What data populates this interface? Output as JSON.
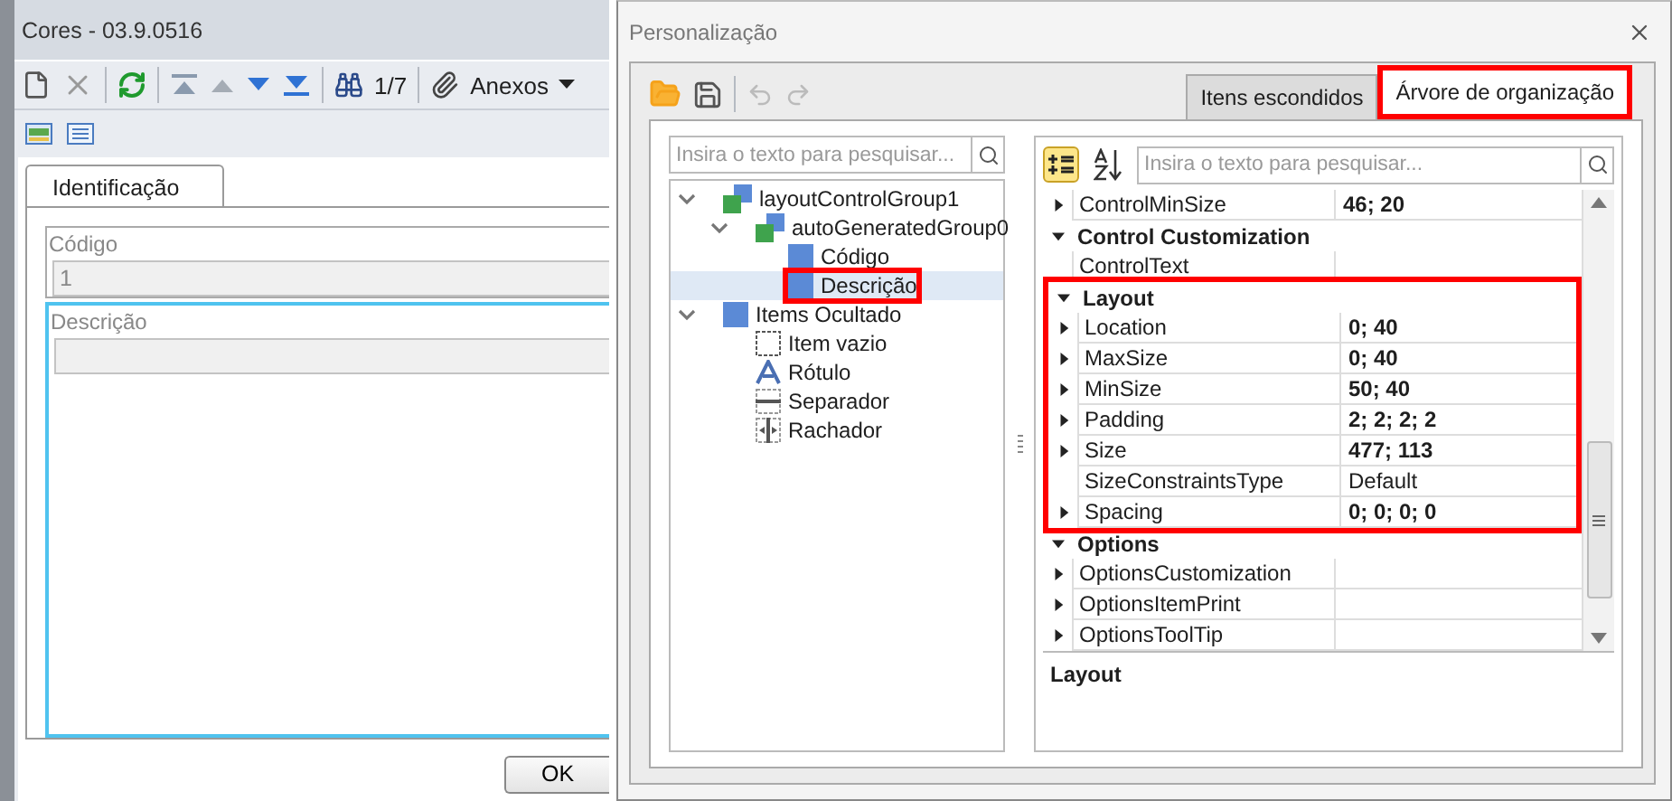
{
  "main_window": {
    "title": "Cores - 03.9.0516",
    "toolbar": {
      "record_counter": "1/7",
      "attachments_label": "Anexos"
    },
    "tabs": [
      {
        "label": "Identificação",
        "selected": true
      }
    ],
    "fields": [
      {
        "label": "Código",
        "value": "1",
        "focused": false
      },
      {
        "label": "Descrição",
        "focused": true
      }
    ],
    "ok_button": "OK"
  },
  "dialog": {
    "title": "Personalização",
    "tabs": [
      {
        "label": "Itens escondidos",
        "selected": false,
        "highlighted": false
      },
      {
        "label": "Árvore de organização",
        "selected": true,
        "highlighted": true
      }
    ],
    "tree_search": {
      "placeholder": "Insira o texto para pesquisar..."
    },
    "tree": [
      {
        "label": "layoutControlGroup1",
        "kind": "group",
        "expanded": true,
        "selected": false,
        "highlighted": false,
        "children": [
          {
            "label": "autoGeneratedGroup0",
            "kind": "group",
            "expanded": true,
            "selected": false,
            "highlighted": false,
            "children": [
              {
                "label": "Código",
                "kind": "item",
                "selected": false,
                "highlighted": false
              },
              {
                "label": "Descrição",
                "kind": "item",
                "selected": true,
                "highlighted": true
              }
            ]
          }
        ]
      },
      {
        "label": "Items Ocultado",
        "kind": "item",
        "expanded": true,
        "selected": false,
        "highlighted": false,
        "children": [
          {
            "label": "Item vazio",
            "kind": "empty",
            "selected": false,
            "highlighted": false
          },
          {
            "label": "Rótulo",
            "kind": "label",
            "selected": false,
            "highlighted": false
          },
          {
            "label": "Separador",
            "kind": "separator",
            "selected": false,
            "highlighted": false
          },
          {
            "label": "Rachador",
            "kind": "splitter",
            "selected": false,
            "highlighted": false
          }
        ]
      }
    ],
    "property_search": {
      "placeholder": "Insira o texto para pesquisar..."
    },
    "property_groups": [
      {
        "rows": [
          {
            "name": "ControlMinSize",
            "value": "46; 20",
            "expandable": true,
            "modified": true
          }
        ]
      },
      {
        "name": "Control Customization",
        "expanded": true,
        "highlighted": false,
        "rows": [
          {
            "name": "ControlText",
            "expandable": false
          }
        ]
      },
      {
        "name": "Layout",
        "expanded": true,
        "highlighted": true,
        "rows": [
          {
            "name": "Location",
            "value": "0; 40",
            "expandable": true,
            "modified": true
          },
          {
            "name": "MaxSize",
            "value": "0; 40",
            "expandable": true,
            "modified": true
          },
          {
            "name": "MinSize",
            "value": "50; 40",
            "expandable": true,
            "modified": true
          },
          {
            "name": "Padding",
            "value": "2; 2; 2; 2",
            "expandable": true,
            "modified": true
          },
          {
            "name": "Size",
            "value": "477; 113",
            "expandable": true,
            "modified": true
          },
          {
            "name": "SizeConstraintsType",
            "value": "Default",
            "expandable": false,
            "modified": false
          },
          {
            "name": "Spacing",
            "value": "0; 0; 0; 0",
            "expandable": true,
            "modified": true
          }
        ]
      },
      {
        "name": "Options",
        "expanded": true,
        "highlighted": false,
        "rows": [
          {
            "name": "OptionsCustomization",
            "expandable": true
          },
          {
            "name": "OptionsItemPrint",
            "expandable": true
          },
          {
            "name": "OptionsToolTip",
            "expandable": true
          }
        ]
      }
    ],
    "description_title": "Layout"
  }
}
